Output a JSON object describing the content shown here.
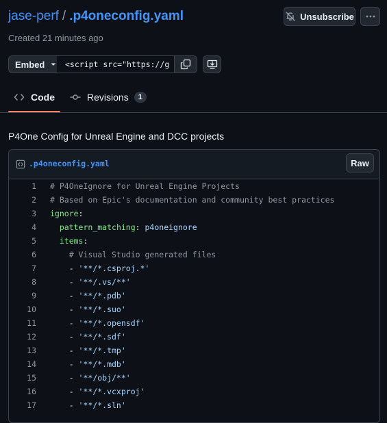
{
  "header": {
    "owner": "jase-perf",
    "separator": "/",
    "filename": ".p4oneconfig.yaml",
    "unsubscribe_label": "Unsubscribe",
    "more_label": "···"
  },
  "created": "Created 21 minutes ago",
  "embed": {
    "select_label": "Embed",
    "input_value": "<script src=\"https://g"
  },
  "tabs": {
    "code_label": "Code",
    "revisions_label": "Revisions",
    "revisions_count": "1"
  },
  "description": "P4One Config for Unreal Engine and DCC projects",
  "file": {
    "name": ".p4oneconfig.yaml",
    "raw_label": "Raw",
    "lines": [
      {
        "n": "1",
        "parts": [
          {
            "t": "# P4OneIgnore for Unreal Engine Projects",
            "c": "comment"
          }
        ]
      },
      {
        "n": "2",
        "parts": [
          {
            "t": "# Based on Epic's documentation and community best practices",
            "c": "comment"
          }
        ]
      },
      {
        "n": "3",
        "parts": [
          {
            "t": "ignore",
            "c": "key"
          },
          {
            "t": ":",
            "c": ""
          }
        ]
      },
      {
        "n": "4",
        "parts": [
          {
            "t": "  ",
            "c": ""
          },
          {
            "t": "pattern_matching",
            "c": "key"
          },
          {
            "t": ": ",
            "c": ""
          },
          {
            "t": "p4oneignore",
            "c": "str"
          }
        ]
      },
      {
        "n": "5",
        "parts": [
          {
            "t": "  ",
            "c": ""
          },
          {
            "t": "items",
            "c": "key"
          },
          {
            "t": ":",
            "c": ""
          }
        ]
      },
      {
        "n": "6",
        "parts": [
          {
            "t": "    # Visual Studio generated files",
            "c": "comment"
          }
        ]
      },
      {
        "n": "7",
        "parts": [
          {
            "t": "    - ",
            "c": ""
          },
          {
            "t": "'**/*.csproj.*'",
            "c": "str"
          }
        ]
      },
      {
        "n": "8",
        "parts": [
          {
            "t": "    - ",
            "c": ""
          },
          {
            "t": "'**/.vs/**'",
            "c": "str"
          }
        ]
      },
      {
        "n": "9",
        "parts": [
          {
            "t": "    - ",
            "c": ""
          },
          {
            "t": "'**/*.pdb'",
            "c": "str"
          }
        ]
      },
      {
        "n": "10",
        "parts": [
          {
            "t": "    - ",
            "c": ""
          },
          {
            "t": "'**/*.suo'",
            "c": "str"
          }
        ]
      },
      {
        "n": "11",
        "parts": [
          {
            "t": "    - ",
            "c": ""
          },
          {
            "t": "'**/*.opensdf'",
            "c": "str"
          }
        ]
      },
      {
        "n": "12",
        "parts": [
          {
            "t": "    - ",
            "c": ""
          },
          {
            "t": "'**/*.sdf'",
            "c": "str"
          }
        ]
      },
      {
        "n": "13",
        "parts": [
          {
            "t": "    - ",
            "c": ""
          },
          {
            "t": "'**/*.tmp'",
            "c": "str"
          }
        ]
      },
      {
        "n": "14",
        "parts": [
          {
            "t": "    - ",
            "c": ""
          },
          {
            "t": "'**/*.mdb'",
            "c": "str"
          }
        ]
      },
      {
        "n": "15",
        "parts": [
          {
            "t": "    - ",
            "c": ""
          },
          {
            "t": "'**/obj/**'",
            "c": "str"
          }
        ]
      },
      {
        "n": "16",
        "parts": [
          {
            "t": "    - ",
            "c": ""
          },
          {
            "t": "'**/*.vcxproj'",
            "c": "str"
          }
        ]
      },
      {
        "n": "17",
        "parts": [
          {
            "t": "    - ",
            "c": ""
          },
          {
            "t": "'**/*.sln'",
            "c": "str"
          }
        ]
      }
    ]
  },
  "colors": {
    "background": "#0d1117",
    "link": "#4493f8",
    "tab_underline": "#f78166",
    "yaml_key": "#7ee787",
    "yaml_string": "#a5d6ff",
    "comment": "#9198a1"
  }
}
